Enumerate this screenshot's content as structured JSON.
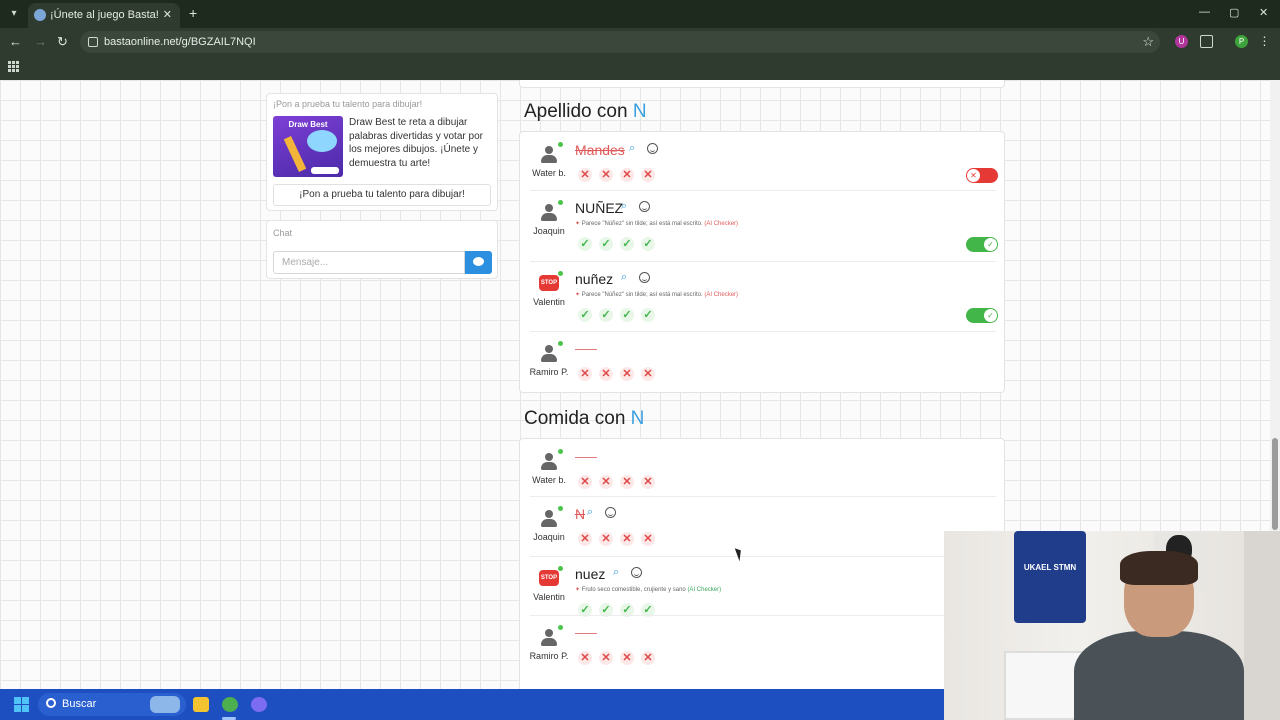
{
  "browser": {
    "tab_title": "¡Únete al juego Basta!",
    "url": "bastaonline.net/g/BGZAIL7NQI",
    "tab_close": "✕",
    "new_tab": "+",
    "window_controls": [
      "—",
      "▢",
      "✕"
    ],
    "nav": {
      "back": "←",
      "forward": "→",
      "reload": "↻"
    },
    "star": "☆",
    "extensions": [
      {
        "letter": "U",
        "color": "#b0369c"
      },
      {
        "letter": "P",
        "color": "#3ea33a"
      }
    ],
    "menu": "⋮"
  },
  "sidebar": {
    "promo": {
      "title": "¡Pon a prueba tu talento para dibujar!",
      "image_label": "Draw Best",
      "text": "Draw Best te reta a dibujar palabras divertidas y votar por los mejores dibujos. ¡Únete y demuestra tu arte!",
      "button": "¡Pon a prueba tu talento para dibujar!"
    },
    "chat": {
      "title": "Chat",
      "placeholder": "Mensaje..."
    }
  },
  "sections": [
    {
      "title": "Apellido con",
      "letter": "N",
      "rows": [
        {
          "player": "Water b.",
          "avatar": "user-icon",
          "answer": "Mandes",
          "style": "struck",
          "note": null,
          "votes": [
            "x",
            "x",
            "x",
            "x"
          ],
          "toggle": "off"
        },
        {
          "player": "Joaquin",
          "avatar": "user-icon",
          "answer": "NUÑEZ",
          "style": "normal",
          "note": "Parece \"Núñez\" sin tilde; así está mal escrito.",
          "note_tag": "(AI Checker)",
          "note_tone": "red",
          "votes": [
            "ok",
            "ok",
            "ok",
            "ok"
          ],
          "toggle": "on"
        },
        {
          "player": "Valentin",
          "avatar": "stop-icon",
          "answer": "nuñez",
          "style": "normal",
          "note": "Parece \"Núñez\" sin tilde; así está mal escrito.",
          "note_tag": "(AI Checker)",
          "note_tone": "red",
          "votes": [
            "ok",
            "ok",
            "ok",
            "ok"
          ],
          "toggle": "on"
        },
        {
          "player": "Ramiro P.",
          "avatar": "user-icon",
          "answer": "",
          "style": "dash",
          "note": null,
          "votes": [
            "x",
            "x",
            "x",
            "x"
          ],
          "toggle": null
        }
      ]
    },
    {
      "title": "Comida con",
      "letter": "N",
      "rows": [
        {
          "player": "Water b.",
          "avatar": "user-icon",
          "answer": "",
          "style": "dash",
          "note": null,
          "votes": [
            "x",
            "x",
            "x",
            "x"
          ],
          "toggle": null
        },
        {
          "player": "Joaquin",
          "avatar": "user-icon",
          "answer": "N",
          "style": "struck",
          "note": null,
          "votes": [
            "x",
            "x",
            "x",
            "x"
          ],
          "toggle": null
        },
        {
          "player": "Valentin",
          "avatar": "stop-icon",
          "answer": "nuez",
          "style": "normal",
          "note": "Fruto seco comestible, crujiente y sano",
          "note_tag": "(AI Checker)",
          "note_tone": "green",
          "votes": [
            "ok",
            "ok",
            "ok",
            "ok"
          ],
          "toggle": null
        },
        {
          "player": "Ramiro P.",
          "avatar": "user-icon",
          "answer": "",
          "style": "dash",
          "note": null,
          "votes": [
            "x",
            "x",
            "x",
            "x"
          ],
          "toggle": null
        }
      ]
    }
  ],
  "stop_label": "STOP",
  "vote_symbols": {
    "x": "✕",
    "ok": "✓"
  },
  "webcam": {
    "jersey_text": "UKAEL STMN"
  },
  "taskbar": {
    "search_label": "Buscar"
  }
}
